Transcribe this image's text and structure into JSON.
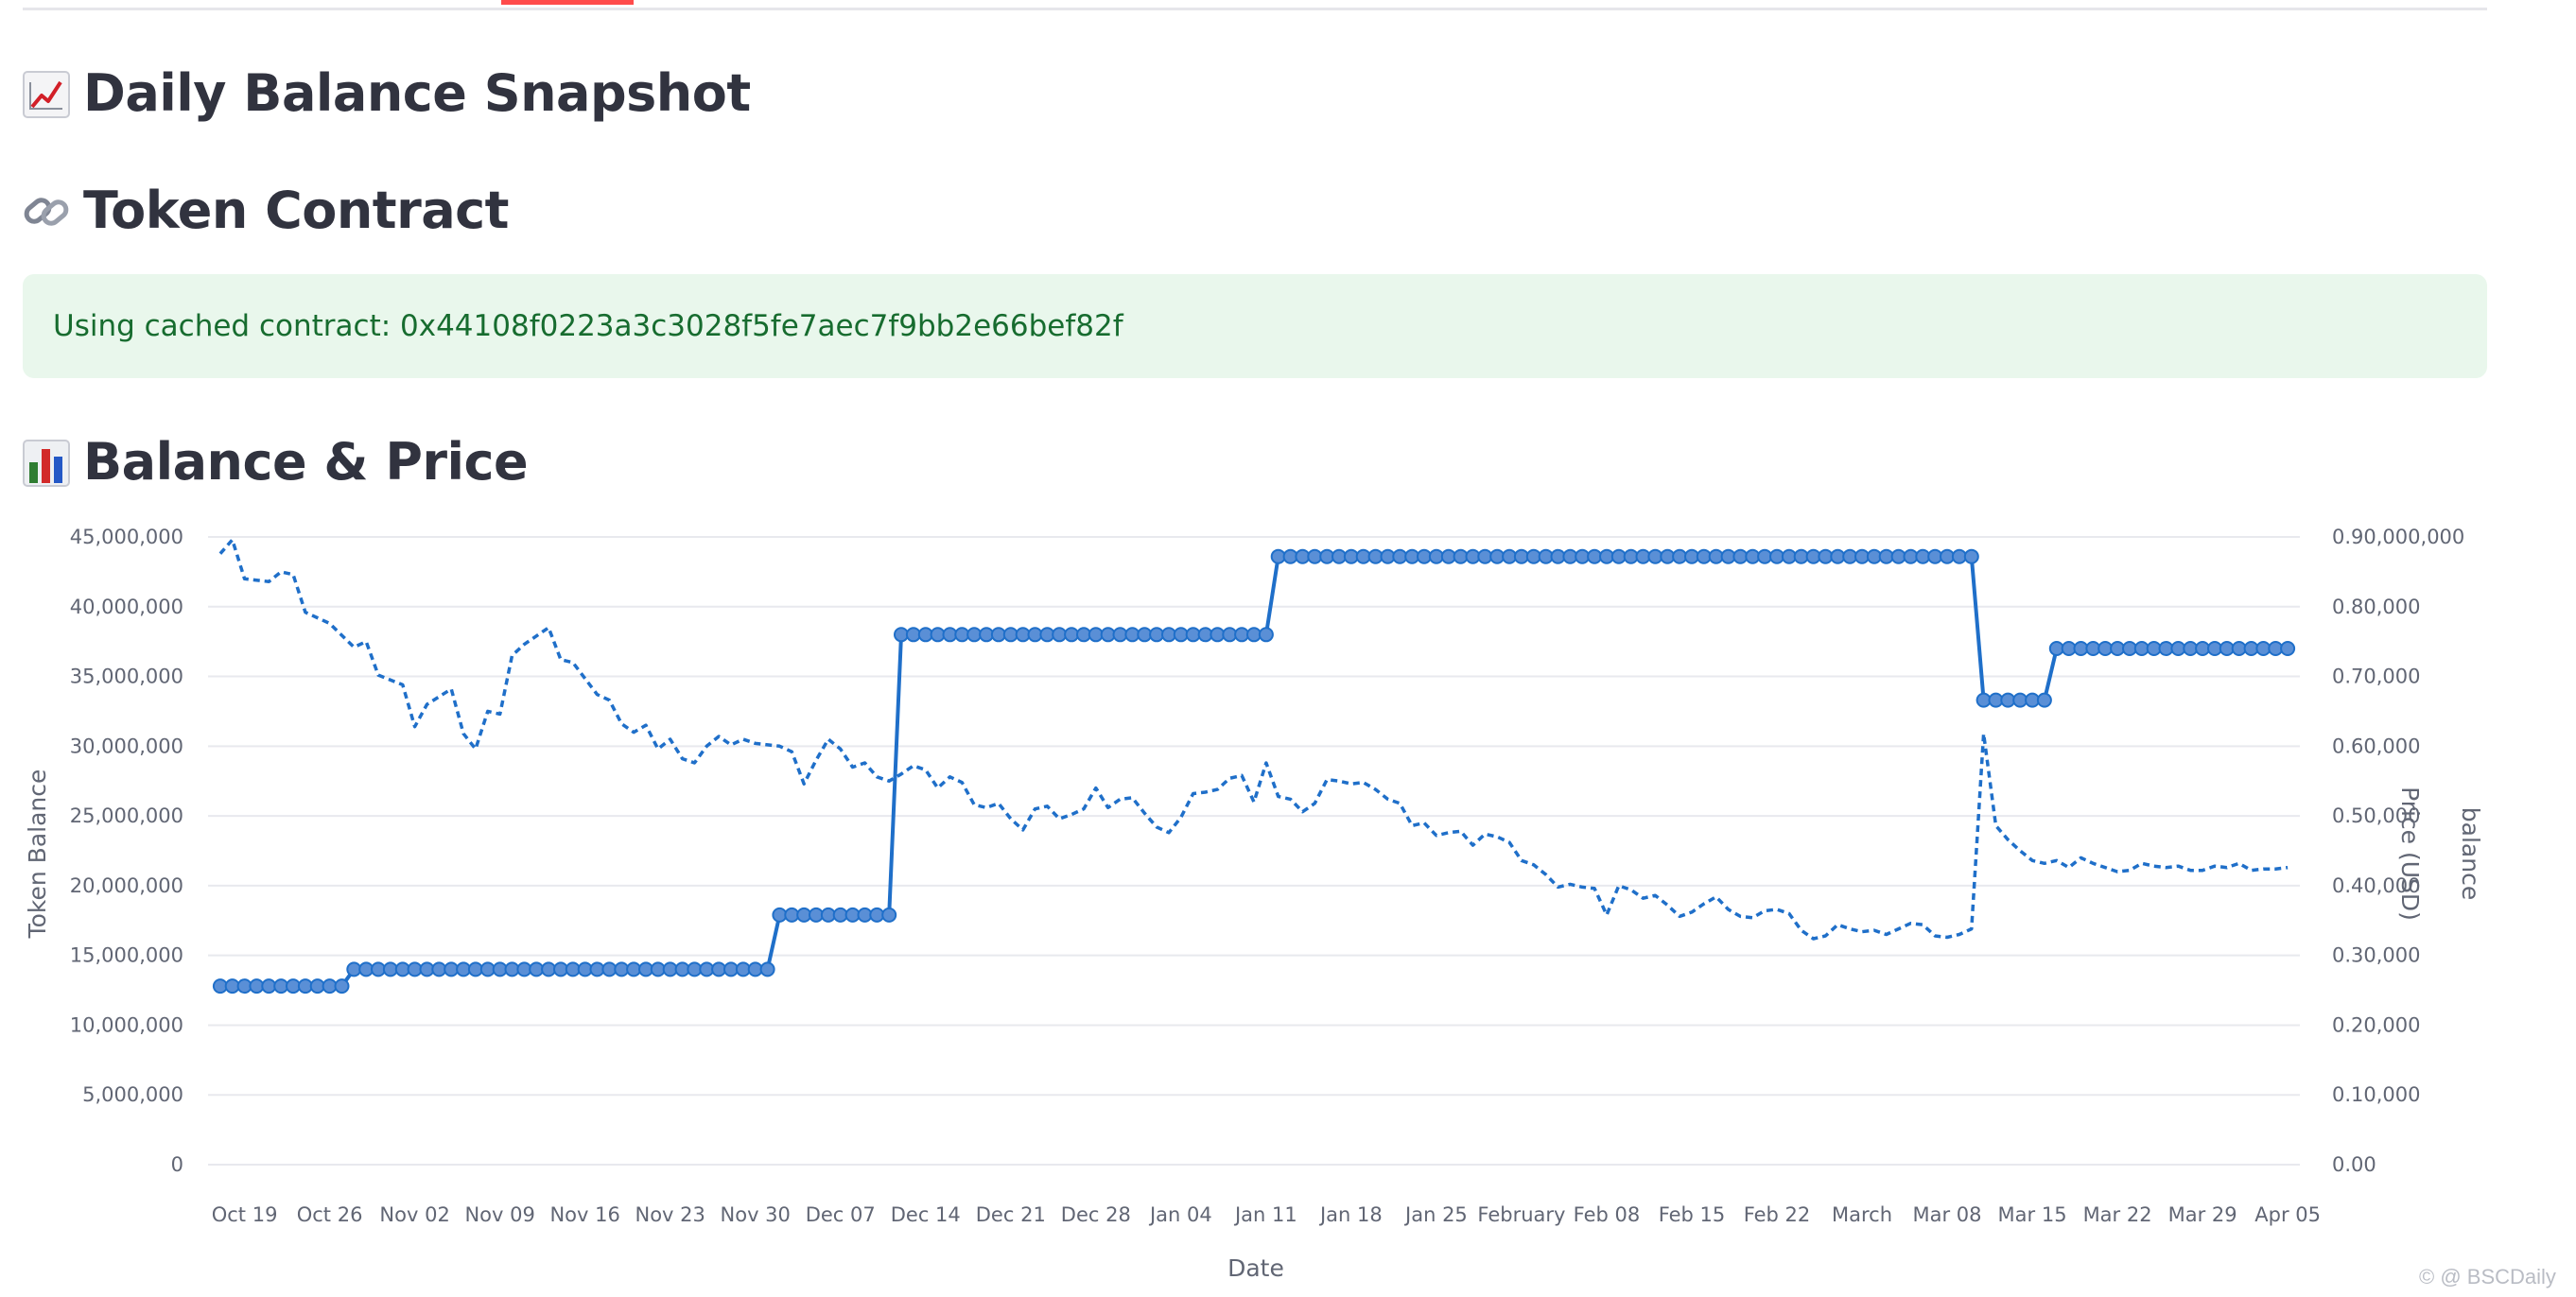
{
  "header": {
    "title": "Daily Balance Snapshot",
    "title_icon": "chart-increasing-icon"
  },
  "contract": {
    "title": "Token Contract",
    "title_icon": "link-icon",
    "message": "Using cached contract: 0x44108f0223a3c3028f5fe7aec7f9bb2e66bef82f"
  },
  "chart_section": {
    "title": "Balance & Price",
    "title_icon": "bar-chart-icon"
  },
  "chart_data": {
    "type": "line",
    "xlabel": "Date",
    "ylabel_left": "Token Balance",
    "ylabel_right": "Price (USD)",
    "ylabel_right2": "balance",
    "left_ticks": [
      "45,000,000",
      "40,000,000",
      "35,000,000",
      "30,000,000",
      "25,000,000",
      "20,000,000",
      "15,000,000",
      "10,000,000",
      "5,000,000",
      "0"
    ],
    "right_ticks": [
      "0.90,000,000",
      "0.80,000",
      "0.70,000",
      "0.60,000",
      "0.50,000",
      "0.40,000",
      "0.30,000",
      "0.20,000",
      "0.10,000",
      "0.00"
    ],
    "ylim_left": [
      0,
      45000000
    ],
    "ylim_right": [
      0,
      0.9
    ],
    "x_ticks": [
      "Oct 19",
      "Oct 26",
      "Nov 02",
      "Nov 09",
      "Nov 16",
      "Nov 23",
      "Nov 30",
      "Dec 07",
      "Dec 14",
      "Dec 21",
      "Dec 28",
      "Jan 04",
      "Jan 11",
      "Jan 18",
      "Jan 25",
      "February",
      "Feb 08",
      "Feb 15",
      "Feb 22",
      "March",
      "Mar 08",
      "Mar 15",
      "Mar 22",
      "Mar 29",
      "Apr 05"
    ],
    "series": [
      {
        "style": "solid-markers",
        "axis": "left",
        "color": "#1f6fc9",
        "steps": [
          {
            "from": "Oct 17",
            "to": "Oct 27",
            "value": 12800000
          },
          {
            "from": "Oct 28",
            "to": "Dec 01",
            "value": 14000000
          },
          {
            "from": "Dec 02",
            "to": "Dec 11",
            "value": 17900000
          },
          {
            "from": "Dec 12",
            "to": "Jan 11",
            "value": 38000000
          },
          {
            "from": "Jan 12",
            "to": "Mar 10",
            "value": 43600000
          },
          {
            "from": "Mar 11",
            "to": "Mar 16",
            "value": 33300000
          },
          {
            "from": "Mar 17",
            "to": "Apr 05",
            "value": 37000000
          }
        ]
      },
      {
        "style": "dashed",
        "axis": "left",
        "color": "#1f6fc9",
        "points": [
          [
            "Oct 17",
            43800000
          ],
          [
            "Oct 18",
            44800000
          ],
          [
            "Oct 19",
            42000000
          ],
          [
            "Oct 21",
            41800000
          ],
          [
            "Oct 22",
            42500000
          ],
          [
            "Oct 23",
            42300000
          ],
          [
            "Oct 24",
            39600000
          ],
          [
            "Oct 26",
            38800000
          ],
          [
            "Oct 28",
            37100000
          ],
          [
            "Oct 29",
            37500000
          ],
          [
            "Oct 30",
            35100000
          ],
          [
            "Nov 01",
            34400000
          ],
          [
            "Nov 02",
            31400000
          ],
          [
            "Nov 03",
            33000000
          ],
          [
            "Nov 05",
            34100000
          ],
          [
            "Nov 06",
            30900000
          ],
          [
            "Nov 07",
            29800000
          ],
          [
            "Nov 08",
            32500000
          ],
          [
            "Nov 09",
            32300000
          ],
          [
            "Nov 10",
            36500000
          ],
          [
            "Nov 11",
            37300000
          ],
          [
            "Nov 13",
            38500000
          ],
          [
            "Nov 14",
            36200000
          ],
          [
            "Nov 15",
            36000000
          ],
          [
            "Nov 17",
            33700000
          ],
          [
            "Nov 18",
            33300000
          ],
          [
            "Nov 19",
            31600000
          ],
          [
            "Nov 20",
            31000000
          ],
          [
            "Nov 21",
            31500000
          ],
          [
            "Nov 22",
            29800000
          ],
          [
            "Nov 23",
            30500000
          ],
          [
            "Nov 24",
            29100000
          ],
          [
            "Nov 25",
            28800000
          ],
          [
            "Nov 26",
            30000000
          ],
          [
            "Nov 27",
            30700000
          ],
          [
            "Nov 28",
            30100000
          ],
          [
            "Nov 29",
            30500000
          ],
          [
            "Nov 30",
            30200000
          ],
          [
            "Dec 02",
            30000000
          ],
          [
            "Dec 03",
            29600000
          ],
          [
            "Dec 04",
            27300000
          ],
          [
            "Dec 05",
            29000000
          ],
          [
            "Dec 06",
            30500000
          ],
          [
            "Dec 07",
            29800000
          ],
          [
            "Dec 08",
            28500000
          ],
          [
            "Dec 09",
            28800000
          ],
          [
            "Dec 10",
            27800000
          ],
          [
            "Dec 11",
            27500000
          ],
          [
            "Dec 12",
            28000000
          ],
          [
            "Dec 13",
            28600000
          ],
          [
            "Dec 14",
            28300000
          ],
          [
            "Dec 15",
            27000000
          ],
          [
            "Dec 16",
            27800000
          ],
          [
            "Dec 17",
            27400000
          ],
          [
            "Dec 18",
            25800000
          ],
          [
            "Dec 19",
            25600000
          ],
          [
            "Dec 20",
            25900000
          ],
          [
            "Dec 21",
            24800000
          ],
          [
            "Dec 22",
            24000000
          ],
          [
            "Dec 23",
            25500000
          ],
          [
            "Dec 24",
            25700000
          ],
          [
            "Dec 25",
            24800000
          ],
          [
            "Dec 26",
            25100000
          ],
          [
            "Dec 27",
            25500000
          ],
          [
            "Dec 28",
            27000000
          ],
          [
            "Dec 29",
            25600000
          ],
          [
            "Dec 30",
            26200000
          ],
          [
            "Dec 31",
            26300000
          ],
          [
            "Jan 01",
            25200000
          ],
          [
            "Jan 02",
            24200000
          ],
          [
            "Jan 03",
            23800000
          ],
          [
            "Jan 04",
            24900000
          ],
          [
            "Jan 05",
            26600000
          ],
          [
            "Jan 06",
            26700000
          ],
          [
            "Jan 07",
            26900000
          ],
          [
            "Jan 08",
            27700000
          ],
          [
            "Jan 09",
            27900000
          ],
          [
            "Jan 10",
            26000000
          ],
          [
            "Jan 11",
            28800000
          ],
          [
            "Jan 12",
            26400000
          ],
          [
            "Jan 13",
            26200000
          ],
          [
            "Jan 14",
            25300000
          ],
          [
            "Jan 15",
            25900000
          ],
          [
            "Jan 16",
            27600000
          ],
          [
            "Jan 17",
            27500000
          ],
          [
            "Jan 18",
            27300000
          ],
          [
            "Jan 19",
            27400000
          ],
          [
            "Jan 20",
            26900000
          ],
          [
            "Jan 21",
            26200000
          ],
          [
            "Jan 22",
            25900000
          ],
          [
            "Jan 23",
            24300000
          ],
          [
            "Jan 24",
            24500000
          ],
          [
            "Jan 25",
            23600000
          ],
          [
            "Jan 26",
            23800000
          ],
          [
            "Jan 27",
            23900000
          ],
          [
            "Jan 28",
            22900000
          ],
          [
            "Jan 29",
            23700000
          ],
          [
            "Jan 30",
            23500000
          ],
          [
            "Jan 31",
            23100000
          ],
          [
            "Feb 01",
            21800000
          ],
          [
            "Feb 02",
            21500000
          ],
          [
            "Feb 03",
            20800000
          ],
          [
            "Feb 04",
            19900000
          ],
          [
            "Feb 05",
            20100000
          ],
          [
            "Feb 06",
            19900000
          ],
          [
            "Feb 07",
            19800000
          ],
          [
            "Feb 08",
            17900000
          ],
          [
            "Feb 09",
            20000000
          ],
          [
            "Feb 10",
            19700000
          ],
          [
            "Feb 11",
            19100000
          ],
          [
            "Feb 12",
            19300000
          ],
          [
            "Feb 13",
            18600000
          ],
          [
            "Feb 14",
            17800000
          ],
          [
            "Feb 15",
            18100000
          ],
          [
            "Feb 16",
            18700000
          ],
          [
            "Feb 17",
            19200000
          ],
          [
            "Feb 18",
            18300000
          ],
          [
            "Feb 19",
            17800000
          ],
          [
            "Feb 20",
            17700000
          ],
          [
            "Feb 21",
            18200000
          ],
          [
            "Feb 22",
            18300000
          ],
          [
            "Feb 23",
            18000000
          ],
          [
            "Feb 24",
            16800000
          ],
          [
            "Feb 25",
            16200000
          ],
          [
            "Feb 26",
            16400000
          ],
          [
            "Feb 27",
            17200000
          ],
          [
            "Feb 28",
            16900000
          ],
          [
            "Mar 01",
            16700000
          ],
          [
            "Mar 02",
            16800000
          ],
          [
            "Mar 03",
            16500000
          ],
          [
            "Mar 04",
            16900000
          ],
          [
            "Mar 05",
            17300000
          ],
          [
            "Mar 06",
            17200000
          ],
          [
            "Mar 07",
            16400000
          ],
          [
            "Mar 08",
            16300000
          ],
          [
            "Mar 09",
            16500000
          ],
          [
            "Mar 10",
            16900000
          ],
          [
            "Mar 11",
            30900000
          ],
          [
            "Mar 12",
            24300000
          ],
          [
            "Mar 13",
            23300000
          ],
          [
            "Mar 14",
            22500000
          ],
          [
            "Mar 15",
            21800000
          ],
          [
            "Mar 16",
            21600000
          ],
          [
            "Mar 17",
            21800000
          ],
          [
            "Mar 18",
            21300000
          ],
          [
            "Mar 19",
            22000000
          ],
          [
            "Mar 20",
            21600000
          ],
          [
            "Mar 21",
            21300000
          ],
          [
            "Mar 22",
            21000000
          ],
          [
            "Mar 23",
            21100000
          ],
          [
            "Mar 24",
            21600000
          ],
          [
            "Mar 25",
            21400000
          ],
          [
            "Mar 26",
            21300000
          ],
          [
            "Mar 27",
            21400000
          ],
          [
            "Mar 28",
            21100000
          ],
          [
            "Mar 29",
            21100000
          ],
          [
            "Mar 30",
            21400000
          ],
          [
            "Mar 31",
            21300000
          ],
          [
            "Apr 01",
            21600000
          ],
          [
            "Apr 02",
            21100000
          ],
          [
            "Apr 03",
            21200000
          ],
          [
            "Apr 04",
            21200000
          ],
          [
            "Apr 05",
            21300000
          ]
        ]
      }
    ],
    "grid": true
  },
  "watermark": "© @ BSCDaily"
}
